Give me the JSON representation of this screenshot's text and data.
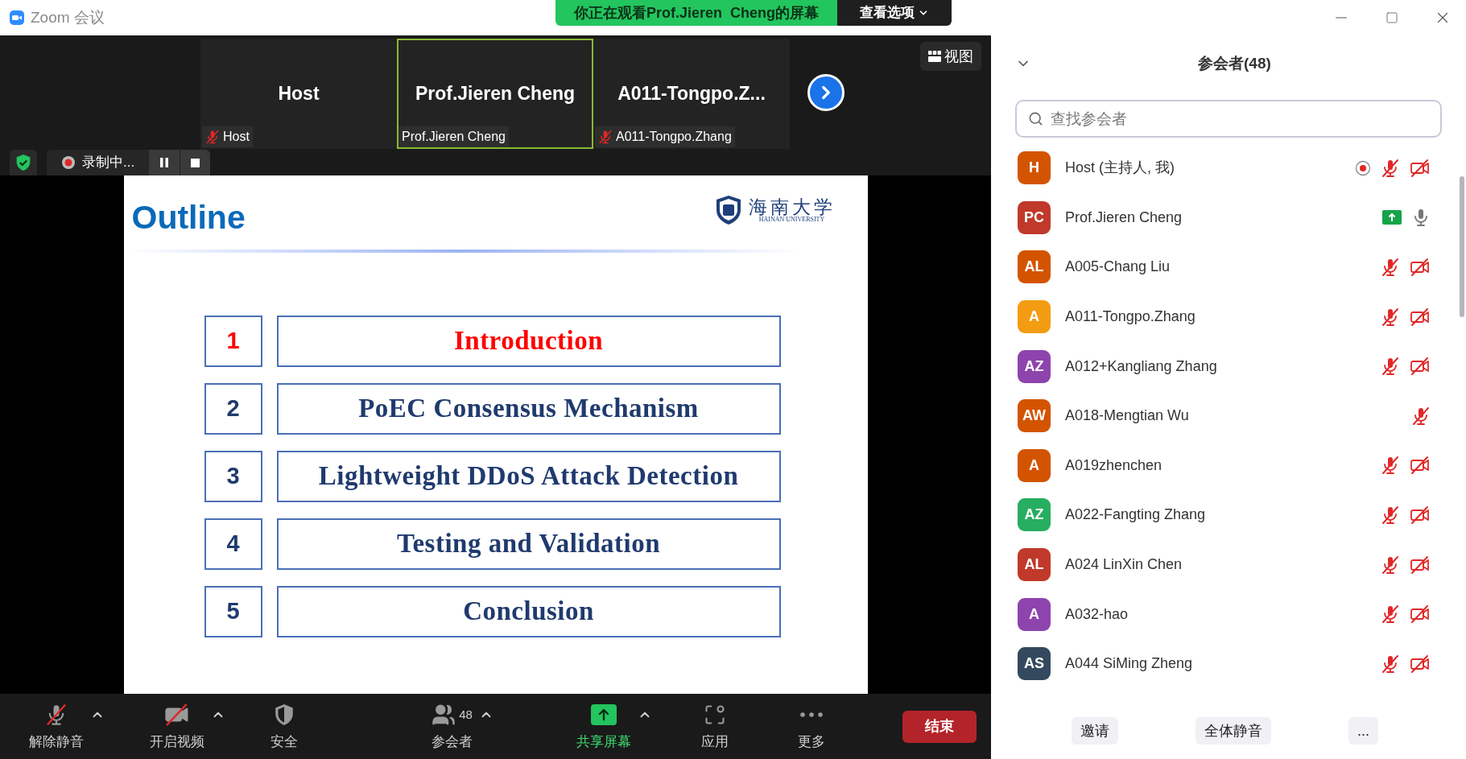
{
  "window": {
    "title": "Zoom 会议",
    "banner": "你正在观看Prof.Jieren  Cheng的屏幕",
    "view_options": "查看选项"
  },
  "gallery": {
    "view_button": "视图",
    "tiles": [
      {
        "name": "Host",
        "label": "Host",
        "muted": true,
        "selected": false
      },
      {
        "name": "Prof.Jieren Cheng",
        "label": "Prof.Jieren Cheng",
        "muted": false,
        "selected": true
      },
      {
        "name": "A011-Tongpo.Z...",
        "label": "A011-Tongpo.Zhang",
        "muted": true,
        "selected": false
      }
    ]
  },
  "recording": {
    "label": "录制中..."
  },
  "slide": {
    "title": "Outline",
    "logo_cn": "海南大学",
    "logo_en": "HAINAN UNIVERSITY",
    "items": [
      {
        "number": "1",
        "title": "Introduction",
        "selected": true
      },
      {
        "number": "2",
        "title": "PoEC Consensus Mechanism",
        "selected": false
      },
      {
        "number": "3",
        "title": "Lightweight DDoS Attack Detection",
        "selected": false
      },
      {
        "number": "4",
        "title": "Testing and Validation",
        "selected": false
      },
      {
        "number": "5",
        "title": "Conclusion",
        "selected": false
      }
    ]
  },
  "toolbar": {
    "end_button": "结束",
    "items": [
      {
        "kind": "mic",
        "label": "解除静音",
        "off": true,
        "caret": true
      },
      {
        "kind": "video",
        "label": "开启视频",
        "off": true,
        "caret": true
      },
      {
        "kind": "security",
        "label": "安全",
        "caret": false
      },
      {
        "kind": "participants",
        "label": "参会者",
        "count": "48",
        "caret": true
      },
      {
        "kind": "share",
        "label": "共享屏幕",
        "caret": true
      },
      {
        "kind": "apps",
        "label": "应用",
        "caret": false
      },
      {
        "kind": "more",
        "label": "更多",
        "caret": false
      }
    ]
  },
  "panel": {
    "title": "参会者(48)",
    "search": {
      "placeholder": "查找参会者"
    },
    "participants": [
      {
        "initials": "H",
        "name": "Host (主持人, 我)",
        "color": "#d35400",
        "recording": true,
        "sharing": false,
        "muted": true,
        "camera_off": true
      },
      {
        "initials": "PC",
        "name": "Prof.Jieren Cheng",
        "color": "#c0392b",
        "recording": false,
        "sharing": true,
        "muted": false,
        "camera_off": false
      },
      {
        "initials": "AL",
        "name": "A005-Chang Liu",
        "color": "#d35400",
        "recording": false,
        "sharing": false,
        "muted": true,
        "camera_off": true
      },
      {
        "initials": "A",
        "name": "A011-Tongpo.Zhang",
        "color": "#f39c12",
        "recording": false,
        "sharing": false,
        "muted": true,
        "camera_off": true
      },
      {
        "initials": "AZ",
        "name": "A012+Kangliang Zhang",
        "color": "#8e44ad",
        "recording": false,
        "sharing": false,
        "muted": true,
        "camera_off": true
      },
      {
        "initials": "AW",
        "name": "A018-Mengtian Wu",
        "color": "#d35400",
        "recording": false,
        "sharing": false,
        "muted": true,
        "camera_off": false
      },
      {
        "initials": "A",
        "name": "A019zhenchen",
        "color": "#d35400",
        "recording": false,
        "sharing": false,
        "muted": true,
        "camera_off": true
      },
      {
        "initials": "AZ",
        "name": "A022-Fangting Zhang",
        "color": "#27ae60",
        "recording": false,
        "sharing": false,
        "muted": true,
        "camera_off": true
      },
      {
        "initials": "AL",
        "name": "A024 LinXin Chen",
        "color": "#c0392b",
        "recording": false,
        "sharing": false,
        "muted": true,
        "camera_off": true
      },
      {
        "initials": "A",
        "name": "A032-hao",
        "color": "#8e44ad",
        "recording": false,
        "sharing": false,
        "muted": true,
        "camera_off": true
      },
      {
        "initials": "AS",
        "name": "A044 SiMing Zheng",
        "color": "#34495e",
        "recording": false,
        "sharing": false,
        "muted": true,
        "camera_off": true
      }
    ],
    "buttons": [
      "邀请",
      "全体静音",
      "..."
    ]
  }
}
